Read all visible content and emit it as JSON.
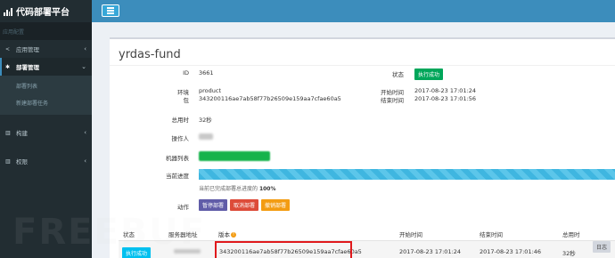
{
  "app": {
    "title": "代码部署平台"
  },
  "sidebar": {
    "section": "应用配置",
    "items": [
      {
        "label": "应用管理",
        "icon": "share-icon",
        "chevron": "‹"
      },
      {
        "label": "部署管理",
        "icon": "settings-icon",
        "chevron": "⌄"
      },
      {
        "label": "构建",
        "icon": "chart-icon",
        "chevron": "‹"
      },
      {
        "label": "权限",
        "icon": "chart-icon",
        "chevron": "‹"
      }
    ],
    "subitems": [
      "部署列表",
      "新建部署任务"
    ]
  },
  "detail": {
    "title": "yrdas-fund",
    "id_label": "ID",
    "id_value": "3661",
    "env_label": "环境",
    "env_value": "product",
    "pkg_label": "包",
    "pkg_value": "343200116ae7ab58f77b26509e159aa7cfae60a5",
    "duration_label": "总用时",
    "duration_value": "32秒",
    "operator_label": "操作人",
    "machines_label": "机器列表",
    "progress_label": "当前进度",
    "progress_note_prefix": "当前已完成部署总进度的",
    "progress_note_value": "100%",
    "progress": 1.0,
    "actions_label": "动作",
    "status_label": "状态",
    "status_value": "执行成功",
    "start_label": "开始时间",
    "start_value": "2017-08-23 17:01:24",
    "end_label": "结束时间",
    "end_value": "2017-08-23 17:01:56",
    "buttons": {
      "pause": "暂停部署",
      "cancel": "取消部署",
      "rollback": "撤销部署"
    }
  },
  "table": {
    "headers": [
      "状态",
      "服务器地址",
      "版本",
      "开始时间",
      "结束时间",
      "总用时"
    ],
    "rows": [
      {
        "status": "执行成功",
        "version": "343200116ae7ab58f77b26509e159aa7cfae60a5",
        "start": "2017-08-23 17:01:24",
        "end": "2017-08-23 17:01:46",
        "duration": "32秒",
        "log": "日志"
      }
    ]
  },
  "watermark": "FREEBUF",
  "colors": {
    "sidebar": "#222d32",
    "topbar": "#3c8dbc",
    "success": "#00a65a",
    "info": "#00c0ef",
    "highlight": "#e0191c"
  }
}
